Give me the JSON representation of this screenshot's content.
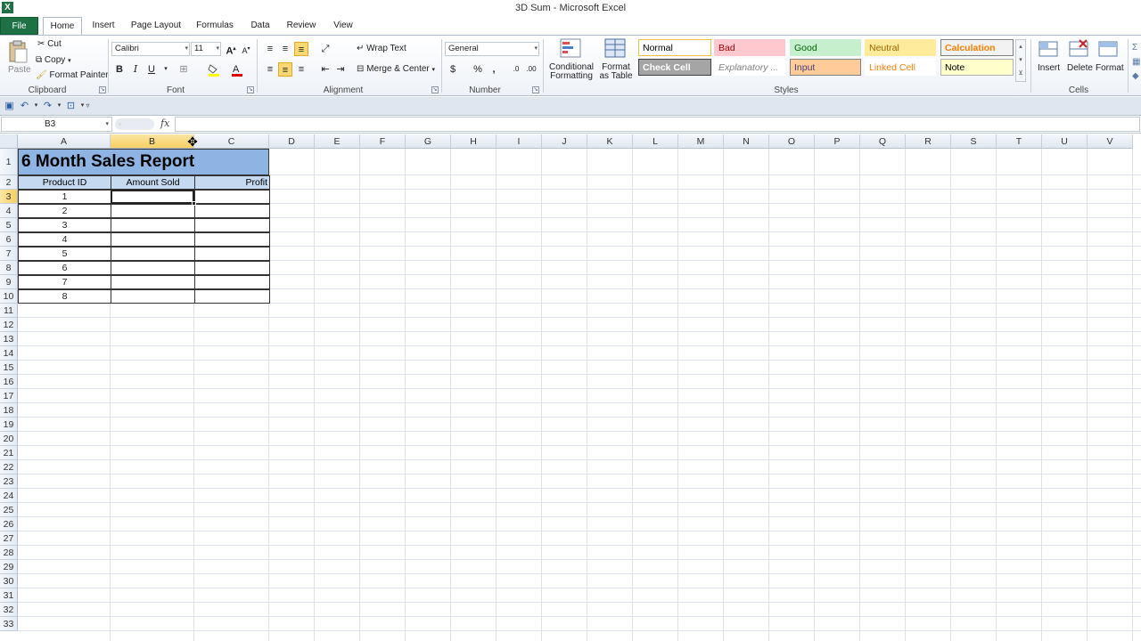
{
  "window": {
    "title": "3D Sum  -  Microsoft Excel",
    "app_icon": "X"
  },
  "tabs": [
    "File",
    "Home",
    "Insert",
    "Page Layout",
    "Formulas",
    "Data",
    "Review",
    "View"
  ],
  "ribbon": {
    "clipboard": {
      "paste": "Paste",
      "cut": "Cut",
      "copy": "Copy",
      "format_painter": "Format Painter",
      "label": "Clipboard"
    },
    "font": {
      "name": "Calibri",
      "size": "11",
      "bold": "B",
      "italic": "I",
      "underline": "U",
      "label": "Font"
    },
    "alignment": {
      "wrap_text": "Wrap Text",
      "merge_center": "Merge & Center",
      "label": "Alignment"
    },
    "number": {
      "format": "General",
      "currency": "$",
      "percent": "%",
      "comma": ",",
      "label": "Number"
    },
    "styles": {
      "conditional_formatting": "Conditional\nFormatting",
      "format_as_table": "Format\nas Table",
      "cells": [
        {
          "label": "Normal",
          "bg": "#ffffff",
          "color": "#000000",
          "border": "#f0c040"
        },
        {
          "label": "Bad",
          "bg": "#ffc7ce",
          "color": "#9c0006",
          "border": "transparent"
        },
        {
          "label": "Good",
          "bg": "#c6efce",
          "color": "#006100",
          "border": "transparent"
        },
        {
          "label": "Neutral",
          "bg": "#ffeb9c",
          "color": "#9c6500",
          "border": "transparent"
        },
        {
          "label": "Calculation",
          "bg": "#f2f2f2",
          "color": "#fa7d00",
          "border": "#7f7f7f"
        },
        {
          "label": "Check Cell",
          "bg": "#a5a5a5",
          "color": "#ffffff",
          "border": "#3f3f3f"
        },
        {
          "label": "Explanatory ...",
          "bg": "#ffffff",
          "color": "#7f7f7f",
          "border": "transparent"
        },
        {
          "label": "Input",
          "bg": "#ffcc99",
          "color": "#3f3f76",
          "border": "#7f7f7f"
        },
        {
          "label": "Linked Cell",
          "bg": "#ffffff",
          "color": "#fa7d00",
          "border": "transparent"
        },
        {
          "label": "Note",
          "bg": "#ffffcc",
          "color": "#000000",
          "border": "#b2b2b2"
        }
      ],
      "label": "Styles"
    },
    "cells": {
      "insert": "Insert",
      "delete": "Delete",
      "format": "Format",
      "label": "Cells"
    }
  },
  "formula_bar": {
    "name_box": "B3",
    "fx": "fx",
    "value": ""
  },
  "sheet": {
    "columns": [
      "A",
      "B",
      "C",
      "D",
      "E",
      "F",
      "G",
      "H",
      "I",
      "J",
      "K",
      "L",
      "M",
      "N",
      "O",
      "P",
      "Q",
      "R",
      "S",
      "T",
      "U",
      "V"
    ],
    "rows": [
      "1",
      "2",
      "3",
      "4",
      "5",
      "6",
      "7",
      "8",
      "9",
      "10",
      "11",
      "12",
      "13",
      "14",
      "15",
      "16",
      "17",
      "18",
      "19",
      "20",
      "21",
      "22",
      "23",
      "24",
      "25",
      "26",
      "27",
      "28",
      "29",
      "30",
      "31",
      "32",
      "33"
    ],
    "selected_column": "B",
    "selected_row": "3",
    "title": "6 Month Sales Report",
    "headers": [
      "Product ID",
      "Amount Sold",
      "Profit"
    ],
    "product_ids": [
      "1",
      "2",
      "3",
      "4",
      "5",
      "6",
      "7",
      "8"
    ]
  }
}
